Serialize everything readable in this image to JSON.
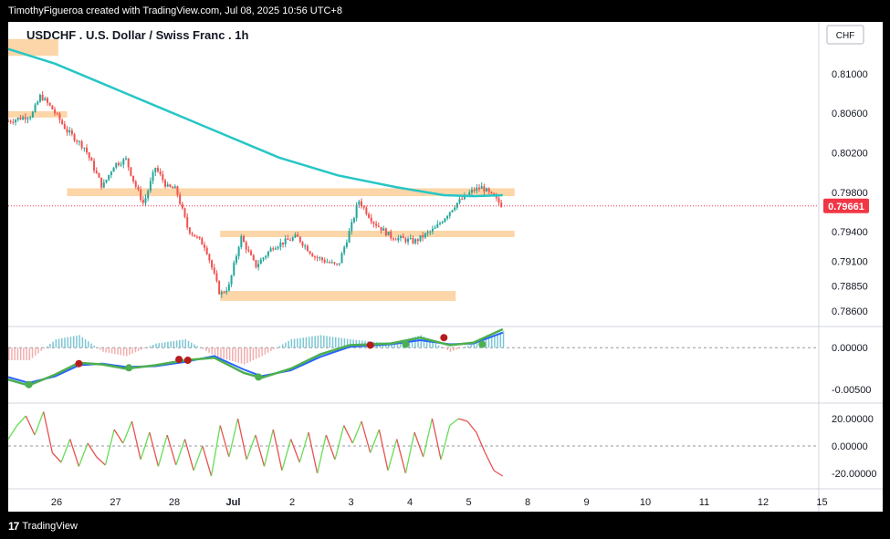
{
  "header": {
    "credit": "TimothyFigueroa created with TradingView.com, Jul 08, 2025 10:56 UTC+8"
  },
  "footer": {
    "logo_glyph": "17",
    "brand": "TradingView"
  },
  "colors": {
    "bull": "#26a69a",
    "bear": "#ef5350",
    "ema": "#26c6c6",
    "zone": "#fcd29f",
    "wt1": "#4caf50",
    "wt2": "#2962ff",
    "wt_cross_up": "#4caf50",
    "wt_cross_down": "#b71c1c",
    "rsi_up": "#66dd55",
    "rsi_down": "#e85050",
    "price_label": "#f23645"
  },
  "chart_data": {
    "type": "candlestick",
    "title": "USDCHF . U.S. Dollar / Swiss Franc . 1h",
    "currency_label": "CHF",
    "last_price": "0.79661",
    "x_tick_labels": [
      "26",
      "27",
      "28",
      "Jul",
      "2",
      "3",
      "4",
      "5",
      "8",
      "9",
      "10",
      "11",
      "12",
      "15"
    ],
    "price_ticks": [
      "0.81000",
      "0.80600",
      "0.80200",
      "0.79800",
      "0.79400",
      "0.79100",
      "0.78850",
      "0.78600"
    ],
    "price_ylim": [
      0.7845,
      0.8145
    ],
    "close_path": [
      {
        "t": 0.0,
        "p": 0.8052
      },
      {
        "t": 0.4,
        "p": 0.8058
      },
      {
        "t": 0.55,
        "p": 0.8078
      },
      {
        "t": 0.75,
        "p": 0.8064
      },
      {
        "t": 1.0,
        "p": 0.8042
      },
      {
        "t": 1.3,
        "p": 0.8025
      },
      {
        "t": 1.6,
        "p": 0.7985
      },
      {
        "t": 1.8,
        "p": 0.8008
      },
      {
        "t": 2.0,
        "p": 0.8013
      },
      {
        "t": 2.15,
        "p": 0.7988
      },
      {
        "t": 2.3,
        "p": 0.7968
      },
      {
        "t": 2.5,
        "p": 0.8005
      },
      {
        "t": 2.7,
        "p": 0.7985
      },
      {
        "t": 2.85,
        "p": 0.7983
      },
      {
        "t": 3.05,
        "p": 0.7943
      },
      {
        "t": 3.35,
        "p": 0.7925
      },
      {
        "t": 3.6,
        "p": 0.7876
      },
      {
        "t": 3.75,
        "p": 0.7885
      },
      {
        "t": 3.95,
        "p": 0.7935
      },
      {
        "t": 4.2,
        "p": 0.7905
      },
      {
        "t": 4.5,
        "p": 0.7925
      },
      {
        "t": 4.9,
        "p": 0.7935
      },
      {
        "t": 5.2,
        "p": 0.7915
      },
      {
        "t": 5.6,
        "p": 0.7905
      },
      {
        "t": 5.85,
        "p": 0.795
      },
      {
        "t": 5.95,
        "p": 0.7972
      },
      {
        "t": 6.2,
        "p": 0.795
      },
      {
        "t": 6.5,
        "p": 0.7935
      },
      {
        "t": 6.9,
        "p": 0.793
      },
      {
        "t": 7.25,
        "p": 0.7943
      },
      {
        "t": 7.6,
        "p": 0.7968
      },
      {
        "t": 7.9,
        "p": 0.7982
      },
      {
        "t": 8.05,
        "p": 0.7985
      },
      {
        "t": 8.2,
        "p": 0.7977
      },
      {
        "t": 8.4,
        "p": 0.7966
      }
    ],
    "ema_path": [
      {
        "t": 0.0,
        "p": 0.8125
      },
      {
        "t": 0.8,
        "p": 0.811
      },
      {
        "t": 1.6,
        "p": 0.809
      },
      {
        "t": 2.6,
        "p": 0.8065
      },
      {
        "t": 3.6,
        "p": 0.804
      },
      {
        "t": 4.6,
        "p": 0.8015
      },
      {
        "t": 5.6,
        "p": 0.7997
      },
      {
        "t": 6.6,
        "p": 0.7985
      },
      {
        "t": 7.4,
        "p": 0.7977
      },
      {
        "t": 7.9,
        "p": 0.7976
      },
      {
        "t": 8.4,
        "p": 0.7977
      }
    ],
    "zones": [
      {
        "t0": 0.0,
        "t1": 0.85,
        "p_lo": 0.8118,
        "p_hi": 0.8135
      },
      {
        "t0": 0.0,
        "t1": 1.0,
        "p_lo": 0.8058,
        "p_hi": 0.8062
      },
      {
        "t0": 1.0,
        "t1": 8.6,
        "p_lo": 0.7976,
        "p_hi": 0.7984
      },
      {
        "t0": 3.6,
        "t1": 8.6,
        "p_lo": 0.7937,
        "p_hi": 0.7941
      },
      {
        "t0": 3.6,
        "t1": 7.6,
        "p_lo": 0.787,
        "p_hi": 0.788
      }
    ],
    "wavetrend": {
      "ticks": [
        "0.00000",
        "-0.00500"
      ],
      "ylim": [
        -0.0065,
        0.0022
      ],
      "zero_line": 0.0,
      "wt1": [
        {
          "t": 0.0,
          "v": -0.0038
        },
        {
          "t": 0.35,
          "v": -0.0045
        },
        {
          "t": 0.8,
          "v": -0.0032
        },
        {
          "t": 1.2,
          "v": -0.0018
        },
        {
          "t": 1.6,
          "v": -0.002
        },
        {
          "t": 2.0,
          "v": -0.0025
        },
        {
          "t": 2.5,
          "v": -0.0021
        },
        {
          "t": 3.0,
          "v": -0.0015
        },
        {
          "t": 3.5,
          "v": -0.0012
        },
        {
          "t": 4.0,
          "v": -0.003
        },
        {
          "t": 4.3,
          "v": -0.0036
        },
        {
          "t": 4.8,
          "v": -0.0025
        },
        {
          "t": 5.3,
          "v": -0.0008
        },
        {
          "t": 5.8,
          "v": 0.0003
        },
        {
          "t": 6.5,
          "v": 0.0005
        },
        {
          "t": 7.0,
          "v": 0.0012
        },
        {
          "t": 7.5,
          "v": 0.0003
        },
        {
          "t": 7.9,
          "v": 0.0006
        },
        {
          "t": 8.4,
          "v": 0.0022
        }
      ],
      "wt2": [
        {
          "t": 0.0,
          "v": -0.0035
        },
        {
          "t": 0.35,
          "v": -0.0042
        },
        {
          "t": 0.8,
          "v": -0.0034
        },
        {
          "t": 1.2,
          "v": -0.0021
        },
        {
          "t": 1.6,
          "v": -0.0019
        },
        {
          "t": 2.0,
          "v": -0.0023
        },
        {
          "t": 2.5,
          "v": -0.0022
        },
        {
          "t": 3.0,
          "v": -0.0017
        },
        {
          "t": 3.5,
          "v": -0.001
        },
        {
          "t": 4.0,
          "v": -0.0026
        },
        {
          "t": 4.3,
          "v": -0.0034
        },
        {
          "t": 4.8,
          "v": -0.0027
        },
        {
          "t": 5.3,
          "v": -0.0011
        },
        {
          "t": 5.8,
          "v": 0.0001
        },
        {
          "t": 6.5,
          "v": 0.0004
        },
        {
          "t": 7.0,
          "v": 0.0009
        },
        {
          "t": 7.5,
          "v": 0.0004
        },
        {
          "t": 7.9,
          "v": 0.0005
        },
        {
          "t": 8.4,
          "v": 0.0018
        }
      ],
      "cross_dots": [
        {
          "t": 0.35,
          "v": -0.0044,
          "dir": "up"
        },
        {
          "t": 1.2,
          "v": -0.0019,
          "dir": "down"
        },
        {
          "t": 2.05,
          "v": -0.0024,
          "dir": "up"
        },
        {
          "t": 2.9,
          "v": -0.0014,
          "dir": "down"
        },
        {
          "t": 3.05,
          "v": -0.0015,
          "dir": "down"
        },
        {
          "t": 4.25,
          "v": -0.0035,
          "dir": "up"
        },
        {
          "t": 6.15,
          "v": 0.0003,
          "dir": "down"
        },
        {
          "t": 6.75,
          "v": 0.0004,
          "dir": "up"
        },
        {
          "t": 7.4,
          "v": 0.0012,
          "dir": "down"
        },
        {
          "t": 8.05,
          "v": 0.0004,
          "dir": "up"
        }
      ]
    },
    "oscillator": {
      "ticks": [
        "20.00000",
        "0.00000",
        "-20.00000"
      ],
      "ylim": [
        -30,
        30
      ],
      "zero_line": 0,
      "path": [
        {
          "t": 0.0,
          "v": 5
        },
        {
          "t": 0.15,
          "v": 15
        },
        {
          "t": 0.3,
          "v": 22
        },
        {
          "t": 0.45,
          "v": 8
        },
        {
          "t": 0.6,
          "v": 25
        },
        {
          "t": 0.75,
          "v": -5
        },
        {
          "t": 0.9,
          "v": -12
        },
        {
          "t": 1.05,
          "v": 5
        },
        {
          "t": 1.2,
          "v": -15
        },
        {
          "t": 1.35,
          "v": 2
        },
        {
          "t": 1.5,
          "v": -8
        },
        {
          "t": 1.65,
          "v": -14
        },
        {
          "t": 1.8,
          "v": 12
        },
        {
          "t": 1.95,
          "v": 2
        },
        {
          "t": 2.1,
          "v": 18
        },
        {
          "t": 2.25,
          "v": -10
        },
        {
          "t": 2.4,
          "v": 10
        },
        {
          "t": 2.55,
          "v": -15
        },
        {
          "t": 2.7,
          "v": 8
        },
        {
          "t": 2.85,
          "v": -14
        },
        {
          "t": 3.0,
          "v": 5
        },
        {
          "t": 3.15,
          "v": -18
        },
        {
          "t": 3.3,
          "v": 0
        },
        {
          "t": 3.45,
          "v": -22
        },
        {
          "t": 3.6,
          "v": 15
        },
        {
          "t": 3.75,
          "v": -8
        },
        {
          "t": 3.9,
          "v": 20
        },
        {
          "t": 4.05,
          "v": -10
        },
        {
          "t": 4.2,
          "v": 8
        },
        {
          "t": 4.35,
          "v": -15
        },
        {
          "t": 4.5,
          "v": 12
        },
        {
          "t": 4.65,
          "v": -18
        },
        {
          "t": 4.8,
          "v": 5
        },
        {
          "t": 4.95,
          "v": -12
        },
        {
          "t": 5.1,
          "v": 10
        },
        {
          "t": 5.25,
          "v": -20
        },
        {
          "t": 5.4,
          "v": 8
        },
        {
          "t": 5.55,
          "v": -10
        },
        {
          "t": 5.7,
          "v": 15
        },
        {
          "t": 5.85,
          "v": 2
        },
        {
          "t": 6.0,
          "v": 18
        },
        {
          "t": 6.15,
          "v": -5
        },
        {
          "t": 6.3,
          "v": 12
        },
        {
          "t": 6.45,
          "v": -18
        },
        {
          "t": 6.6,
          "v": 5
        },
        {
          "t": 6.75,
          "v": -20
        },
        {
          "t": 6.9,
          "v": 10
        },
        {
          "t": 7.05,
          "v": -8
        },
        {
          "t": 7.2,
          "v": 20
        },
        {
          "t": 7.35,
          "v": -10
        },
        {
          "t": 7.5,
          "v": 15
        },
        {
          "t": 7.65,
          "v": 20
        },
        {
          "t": 7.8,
          "v": 18
        },
        {
          "t": 7.95,
          "v": 10
        },
        {
          "t": 8.1,
          "v": -5
        },
        {
          "t": 8.25,
          "v": -18
        },
        {
          "t": 8.4,
          "v": -22
        }
      ]
    }
  }
}
